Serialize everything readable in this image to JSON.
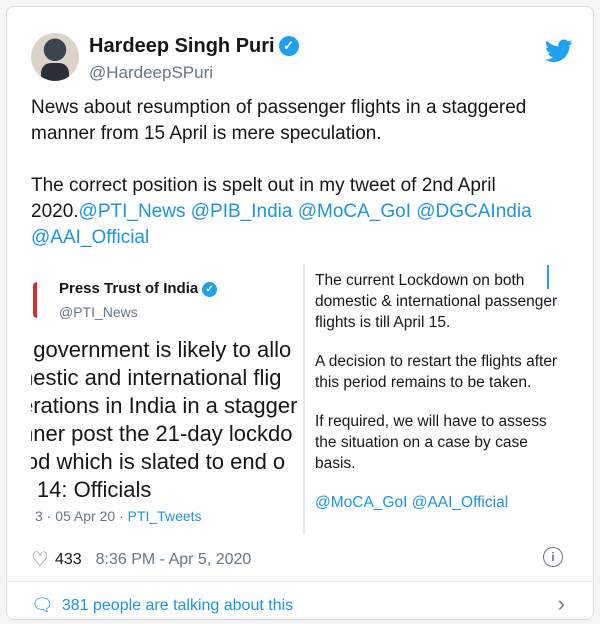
{
  "author": {
    "name": "Hardeep Singh Puri",
    "handle": "@HardeepSPuri",
    "verified_symbol": "✓"
  },
  "tweet": {
    "line1": "News about resumption of passenger flights in a staggered",
    "line2": "manner from 15 April is mere speculation.",
    "line3": "The correct position is spelt out in my tweet of 2nd April",
    "line4_text": "2020.",
    "mentions_line4": "@PTI_News @PIB_India @MoCA_GoI @DGCAIndia",
    "mentions_line5": "@AAI_Official"
  },
  "embedded_tweet": {
    "name": "Press Trust of India",
    "handle": "@PTI_News",
    "lines": [
      ": government is likely to allo",
      "nestic and international flig",
      "erations in India in a stagger",
      "nner post the 21-day lockdo",
      "iod which is slated to end o",
      "il 14: Officials"
    ],
    "meta_date": "3 · 05 Apr 20 · ",
    "meta_source": "PTI_Tweets"
  },
  "quoted_card": {
    "p1": "The current Lockdown on both domestic & international passenger flights is till April 15.",
    "p2": "A decision to restart the flights after this period remains to be taken.",
    "p3": "If required, we will have to assess the situation on a case by case basis.",
    "p4": "@MoCA_GoI @AAI_Official"
  },
  "footer": {
    "likes": "433",
    "timestamp": "8:36 PM - Apr 5, 2020",
    "talking": "381 people are talking about this"
  },
  "colors": {
    "link": "#1b95e0",
    "twitter_blue": "#1da1f2"
  }
}
